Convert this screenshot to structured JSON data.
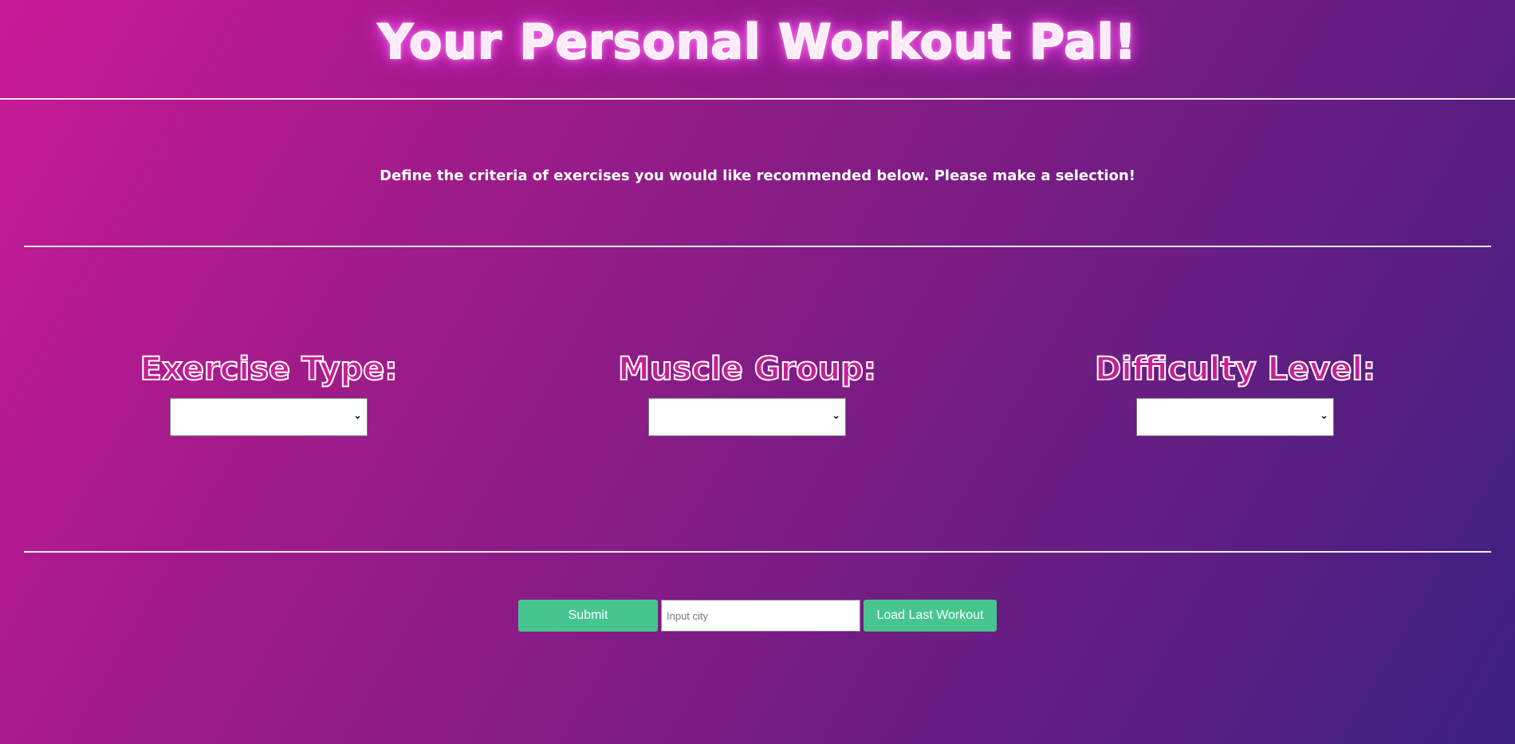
{
  "header": {
    "title": "Your Personal Workout Pal!"
  },
  "intro": {
    "text": "Define the criteria of exercises you would like recommended below. Please make a selection!"
  },
  "criteria": [
    {
      "label": "Exercise Type:",
      "selected": ""
    },
    {
      "label": "Muscle Group:",
      "selected": ""
    },
    {
      "label": "Difficulty Level:",
      "selected": ""
    }
  ],
  "actions": {
    "submit_label": "Submit",
    "city_placeholder": "Input city",
    "city_value": "",
    "load_label": "Load Last Workout"
  },
  "colors": {
    "button_green": "#46c68e",
    "background_start": "#c81a96",
    "background_end": "#3c2180",
    "title_glow": "#f35ee6"
  },
  "icons": {
    "select_chevron": "chevron-down-icon"
  }
}
